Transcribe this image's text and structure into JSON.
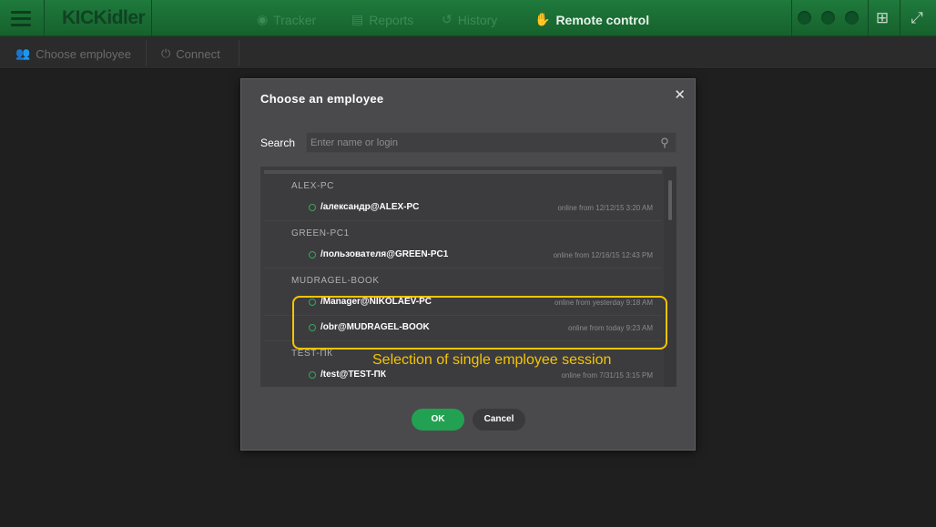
{
  "app": {
    "logo": "KICKidler"
  },
  "nav": [
    {
      "label": "Tracker",
      "icon": "eye-icon"
    },
    {
      "label": "Reports",
      "icon": "document-icon"
    },
    {
      "label": "History",
      "icon": "history-icon"
    },
    {
      "label": "Remote control",
      "icon": "remote-control-icon",
      "active": true
    }
  ],
  "toolbar": {
    "choose_employee": "Choose employee",
    "connect": "Connect"
  },
  "dialog": {
    "title": "Choose an employee",
    "search_label": "Search",
    "search_placeholder": "Enter name or login",
    "groups": [
      {
        "name": "ALEX-PC",
        "sessions": [
          {
            "login": "/александр@ALEX-PC",
            "since": "online from 12/12/15 3:20 AM"
          }
        ]
      },
      {
        "name": "GREEN-PC1",
        "sessions": [
          {
            "login": "/пользователя@GREEN-PC1",
            "since": "online from 12/16/15 12:43 PM"
          }
        ]
      },
      {
        "name": "MUDRAGEL-BOOK",
        "sessions": [
          {
            "login": "/Manager@NIKOLAEV-PC",
            "since": "online from yesterday 9:18 AM"
          },
          {
            "login": "/obr@MUDRAGEL-BOOK",
            "since": "online from today 9:23 AM"
          }
        ]
      },
      {
        "name": "TEST-ПК",
        "sessions": [
          {
            "login": "/test@TEST-ПК",
            "since": "online from 7/31/15 3:15 PM"
          }
        ]
      }
    ],
    "ok_label": "OK",
    "cancel_label": "Cancel"
  },
  "annotation": "Selection of single employee session",
  "colors": {
    "accent": "#23a152",
    "topbar": "#1f7a3c",
    "highlight": "#f5c400"
  }
}
